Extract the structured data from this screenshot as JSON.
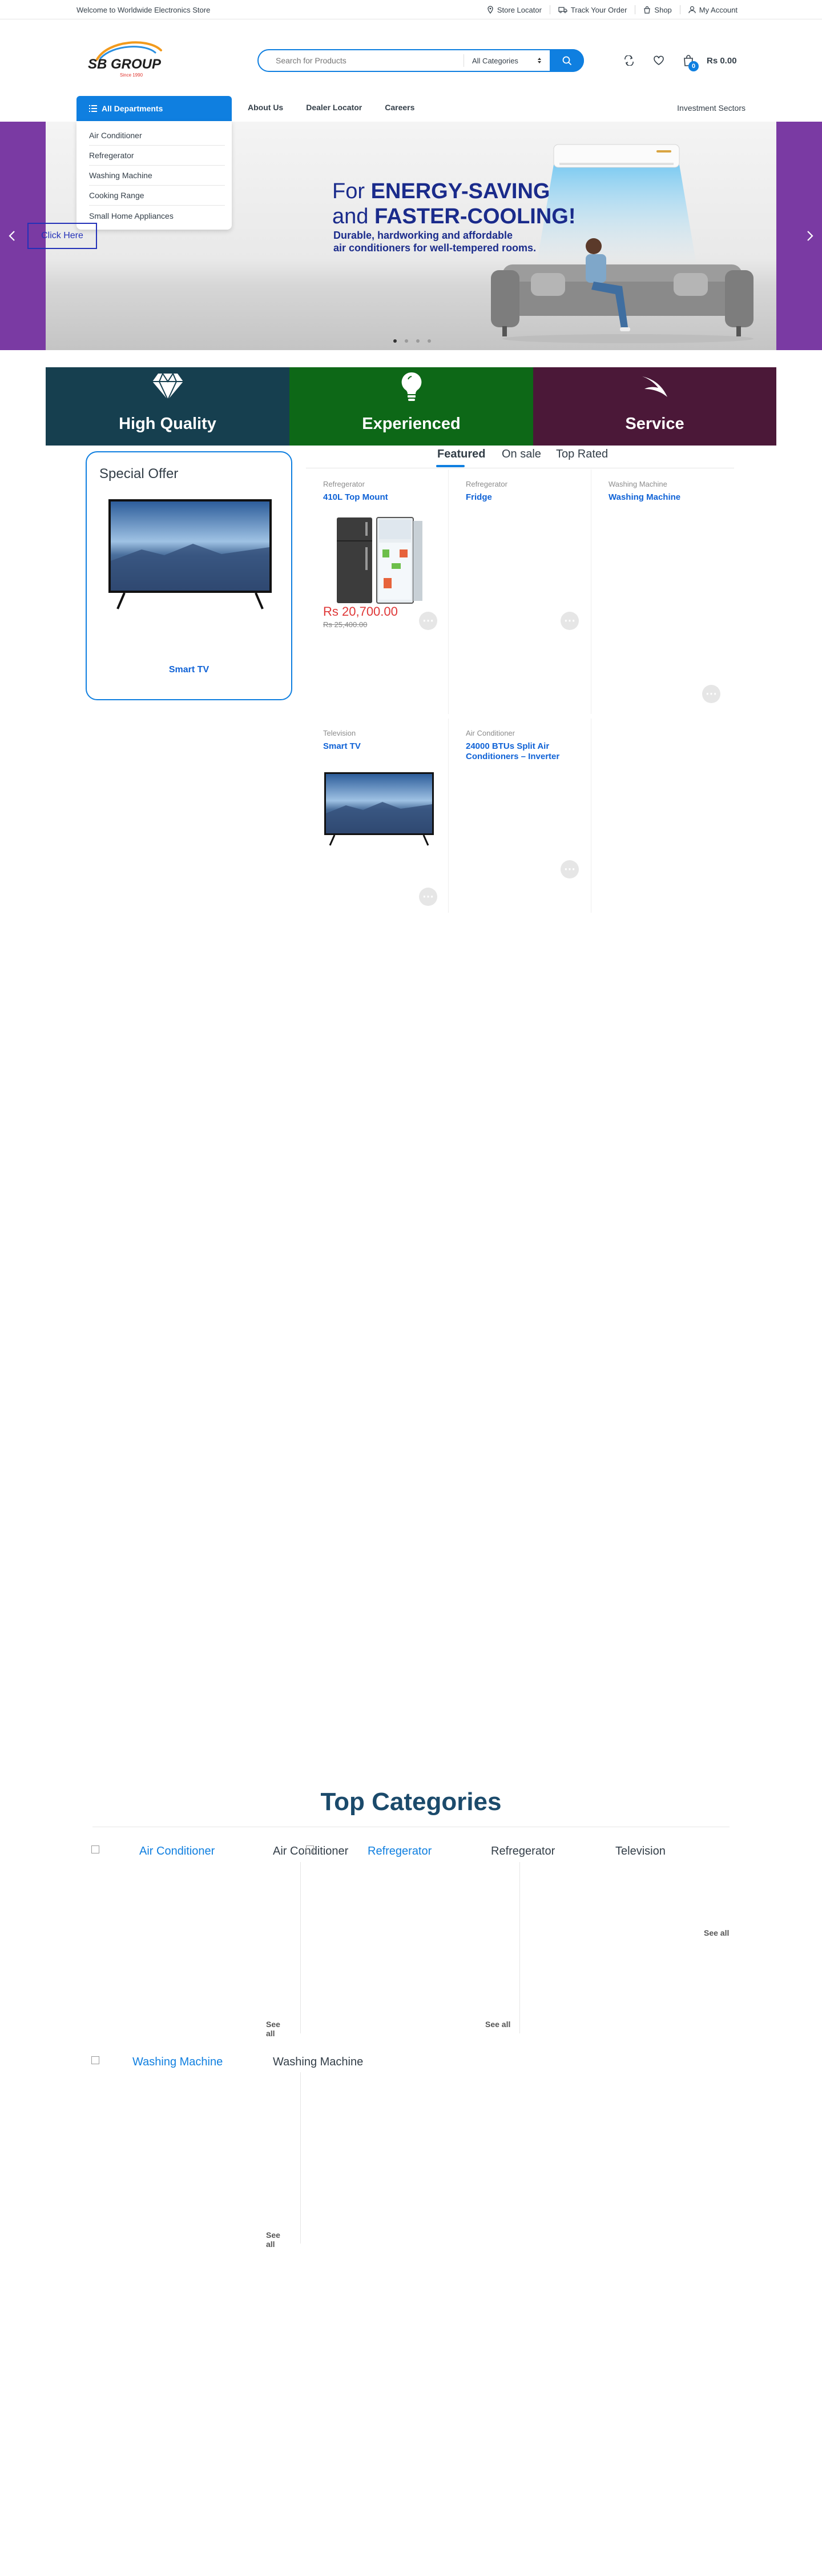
{
  "topbar": {
    "welcome": "Welcome to Worldwide Electronics Store",
    "links": [
      {
        "label": "Store Locator",
        "icon": "map-pin-icon"
      },
      {
        "label": "Track Your Order",
        "icon": "truck-icon"
      },
      {
        "label": "Shop",
        "icon": "shopping-bag-icon"
      },
      {
        "label": "My Account",
        "icon": "user-icon"
      }
    ]
  },
  "header": {
    "logo_text": "SB GROUP",
    "logo_tagline": "Since 1990",
    "search_placeholder": "Search for Products",
    "search_category": "All Categories",
    "cart_count": "0",
    "cart_total": "Rs 0.00"
  },
  "nav": {
    "departments_label": "All Departments",
    "departments": [
      "Air Conditioner",
      "Refregerator",
      "Washing Machine",
      "Cooking Range",
      "Small Home Appliances"
    ],
    "main": [
      "About Us",
      "Dealer Locator",
      "Careers"
    ],
    "right": "Investment Sectors"
  },
  "hero": {
    "headline_1_pre": "For ",
    "headline_1_bold": "ENERGY-SAVING",
    "headline_2_pre": "and ",
    "headline_2_bold": "FASTER-COOLING!",
    "sub_1": "Durable, hardworking and affordable",
    "sub_2": "air conditioners for well-tempered rooms.",
    "cta": "Click Here",
    "slide_count": 4,
    "active_slide": 1
  },
  "features": [
    {
      "label": "High Quality",
      "icon": "diamond-icon",
      "color": "#163f4f"
    },
    {
      "label": "Experienced",
      "icon": "lightbulb-icon",
      "color": "#0d6817"
    },
    {
      "label": "Service",
      "icon": "service-swoosh-icon",
      "color": "#4b1838"
    }
  ],
  "special_offer": {
    "title": "Special Offer",
    "product": "Smart TV"
  },
  "tabs": [
    "Featured",
    "On sale",
    "Top Rated"
  ],
  "products": [
    {
      "category": "Refregerator",
      "name": "410L Top Mount",
      "price": "Rs 20,700.00",
      "old_price": "Rs 25,400.00"
    },
    {
      "category": "Refregerator",
      "name": "Fridge"
    },
    {
      "category": "Washing Machine",
      "name": "Washing Machine"
    },
    {
      "category": "Television",
      "name": "Smart TV"
    },
    {
      "category": "Air Conditioner",
      "name": "24000 BTUs Split Air Conditioners – Inverter"
    }
  ],
  "top_categories": {
    "title": "Top Categories",
    "see_all": "See all",
    "items": [
      {
        "image_alt": "Air Conditioner",
        "name": "Air Conditioner"
      },
      {
        "image_alt": "Refregerator",
        "name": "Refregerator"
      },
      {
        "image_alt": "",
        "name": "Television"
      },
      {
        "image_alt": "Washing Machine",
        "name": "Washing Machine"
      }
    ]
  },
  "colors": {
    "primary": "#0f7fe0",
    "hero_side": "#7a3aa3",
    "price": "#df3737",
    "heading": "#1b4a6b"
  }
}
